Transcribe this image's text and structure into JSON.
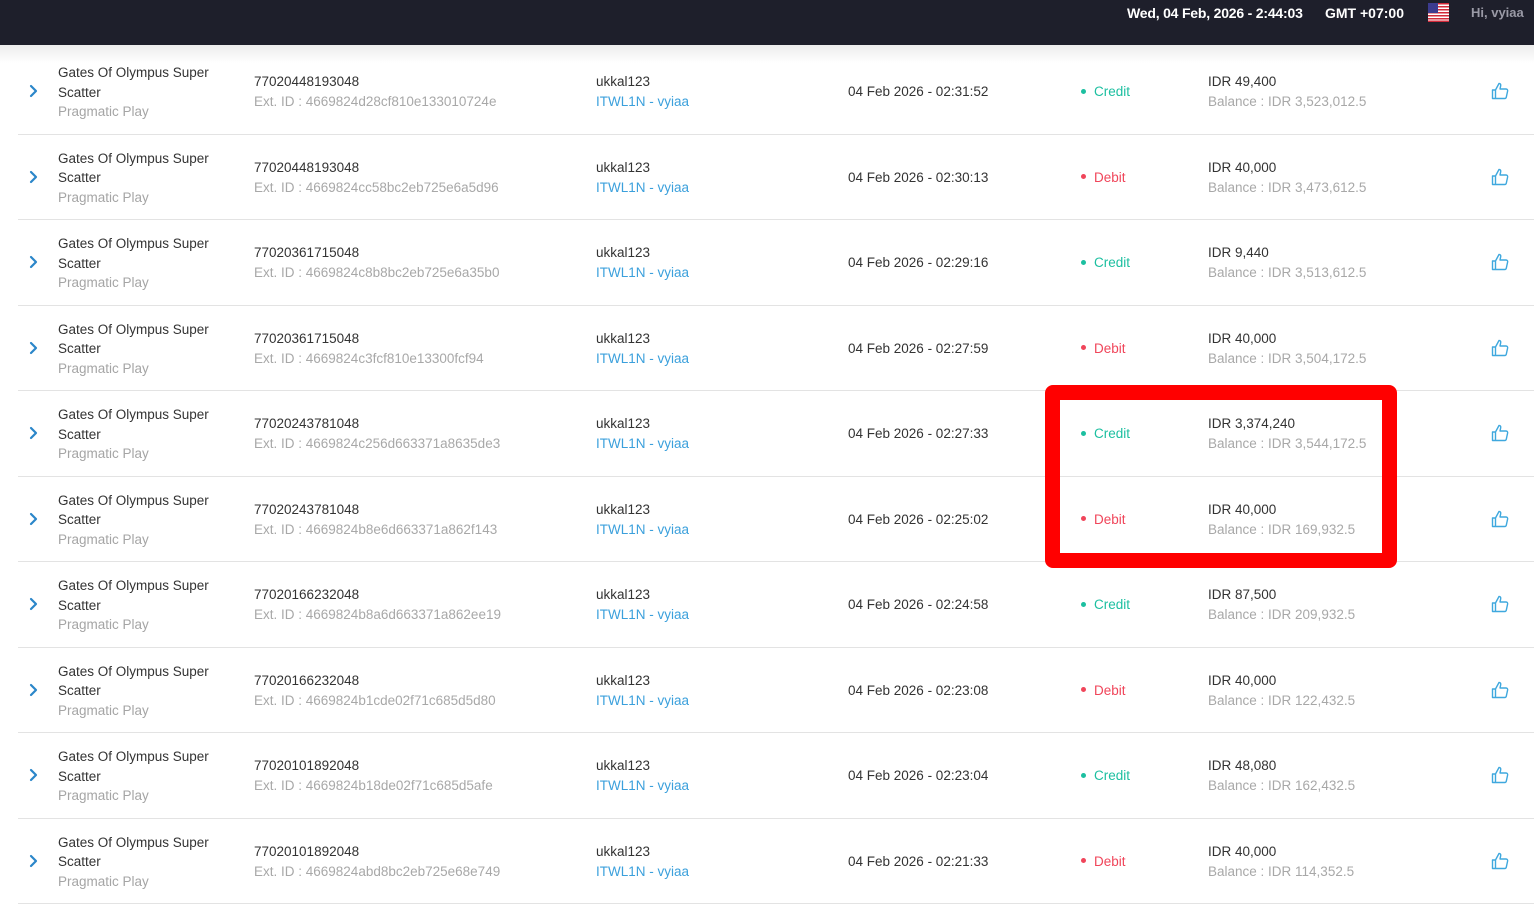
{
  "header": {
    "datetime": "Wed, 04 Feb, 2026 - 2:44:03",
    "timezone": "GMT +07:00",
    "greeting": "Hi, vyiaa",
    "flag_icon": "us-flag-icon"
  },
  "colors": {
    "credit": "#1cbfa0",
    "debit": "#f0455a",
    "link": "#3ba0dc",
    "highlight": "#ff0000",
    "topbar": "#1e1f2b"
  },
  "transactions": [
    {
      "game": "Gates Of Olympus Super Scatter",
      "provider": "Pragmatic Play",
      "tx_id": "77020448193048",
      "ext_id": "Ext. ID : 4669824d28cf810e133010724e",
      "user": "ukkal123",
      "agent": "ITWL1N - vyiaa",
      "date": "04 Feb 2026 - 02:31:52",
      "type": "Credit",
      "amount": "IDR 49,400",
      "balance": "Balance : IDR 3,523,012.5"
    },
    {
      "game": "Gates Of Olympus Super Scatter",
      "provider": "Pragmatic Play",
      "tx_id": "77020448193048",
      "ext_id": "Ext. ID : 4669824cc58bc2eb725e6a5d96",
      "user": "ukkal123",
      "agent": "ITWL1N - vyiaa",
      "date": "04 Feb 2026 - 02:30:13",
      "type": "Debit",
      "amount": "IDR 40,000",
      "balance": "Balance : IDR 3,473,612.5"
    },
    {
      "game": "Gates Of Olympus Super Scatter",
      "provider": "Pragmatic Play",
      "tx_id": "77020361715048",
      "ext_id": "Ext. ID : 4669824c8b8bc2eb725e6a35b0",
      "user": "ukkal123",
      "agent": "ITWL1N - vyiaa",
      "date": "04 Feb 2026 - 02:29:16",
      "type": "Credit",
      "amount": "IDR 9,440",
      "balance": "Balance : IDR 3,513,612.5"
    },
    {
      "game": "Gates Of Olympus Super Scatter",
      "provider": "Pragmatic Play",
      "tx_id": "77020361715048",
      "ext_id": "Ext. ID : 4669824c3fcf810e13300fcf94",
      "user": "ukkal123",
      "agent": "ITWL1N - vyiaa",
      "date": "04 Feb 2026 - 02:27:59",
      "type": "Debit",
      "amount": "IDR 40,000",
      "balance": "Balance : IDR 3,504,172.5"
    },
    {
      "game": "Gates Of Olympus Super Scatter",
      "provider": "Pragmatic Play",
      "tx_id": "77020243781048",
      "ext_id": "Ext. ID : 4669824c256d663371a8635de3",
      "user": "ukkal123",
      "agent": "ITWL1N - vyiaa",
      "date": "04 Feb 2026 - 02:27:33",
      "type": "Credit",
      "amount": "IDR 3,374,240",
      "balance": "Balance : IDR 3,544,172.5"
    },
    {
      "game": "Gates Of Olympus Super Scatter",
      "provider": "Pragmatic Play",
      "tx_id": "77020243781048",
      "ext_id": "Ext. ID : 4669824b8e6d663371a862f143",
      "user": "ukkal123",
      "agent": "ITWL1N - vyiaa",
      "date": "04 Feb 2026 - 02:25:02",
      "type": "Debit",
      "amount": "IDR 40,000",
      "balance": "Balance : IDR 169,932.5"
    },
    {
      "game": "Gates Of Olympus Super Scatter",
      "provider": "Pragmatic Play",
      "tx_id": "77020166232048",
      "ext_id": "Ext. ID : 4669824b8a6d663371a862ee19",
      "user": "ukkal123",
      "agent": "ITWL1N - vyiaa",
      "date": "04 Feb 2026 - 02:24:58",
      "type": "Credit",
      "amount": "IDR 87,500",
      "balance": "Balance : IDR 209,932.5"
    },
    {
      "game": "Gates Of Olympus Super Scatter",
      "provider": "Pragmatic Play",
      "tx_id": "77020166232048",
      "ext_id": "Ext. ID : 4669824b1cde02f71c685d5d80",
      "user": "ukkal123",
      "agent": "ITWL1N - vyiaa",
      "date": "04 Feb 2026 - 02:23:08",
      "type": "Debit",
      "amount": "IDR 40,000",
      "balance": "Balance : IDR 122,432.5"
    },
    {
      "game": "Gates Of Olympus Super Scatter",
      "provider": "Pragmatic Play",
      "tx_id": "77020101892048",
      "ext_id": "Ext. ID : 4669824b18de02f71c685d5afe",
      "user": "ukkal123",
      "agent": "ITWL1N - vyiaa",
      "date": "04 Feb 2026 - 02:23:04",
      "type": "Credit",
      "amount": "IDR 48,080",
      "balance": "Balance : IDR 162,432.5"
    },
    {
      "game": "Gates Of Olympus Super Scatter",
      "provider": "Pragmatic Play",
      "tx_id": "77020101892048",
      "ext_id": "Ext. ID : 4669824abd8bc2eb725e68e749",
      "user": "ukkal123",
      "agent": "ITWL1N - vyiaa",
      "date": "04 Feb 2026 - 02:21:33",
      "type": "Debit",
      "amount": "IDR 40,000",
      "balance": "Balance : IDR 114,352.5"
    }
  ],
  "icons": {
    "expand": "chevron-right-icon",
    "action": "thumbs-up-icon"
  }
}
